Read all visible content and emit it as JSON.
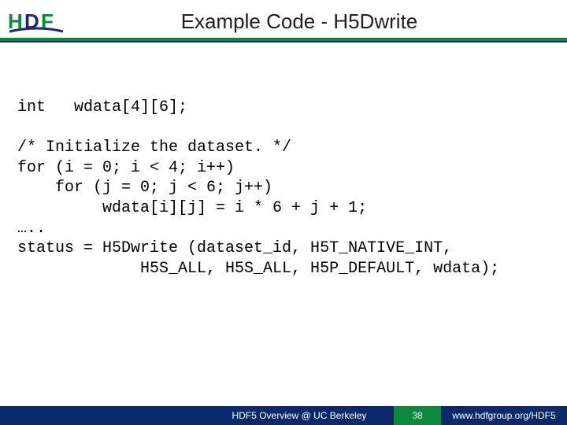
{
  "header": {
    "title": "Example Code -  H5Dwrite",
    "logo_alt": "HDF"
  },
  "code": {
    "line1": "int   wdata[4][6];",
    "line2": "",
    "line3": "/* Initialize the dataset. */",
    "line4": "for (i = 0; i < 4; i++)",
    "line5": "    for (j = 0; j < 6; j++)",
    "line6": "         wdata[i][j] = i * 6 + j + 1;",
    "line7": "…..",
    "line8": "status = H5Dwrite (dataset_id, H5T_NATIVE_INT,",
    "line9": "             H5S_ALL, H5S_ALL, H5P_DEFAULT, wdata);"
  },
  "footer": {
    "mid": "HDF5 Overview @ UC Berkeley",
    "page": "38",
    "right": "www.hdfgroup.org/HDF5"
  },
  "colors": {
    "green": "#0a8a3a",
    "navy": "#0b2a6b"
  }
}
